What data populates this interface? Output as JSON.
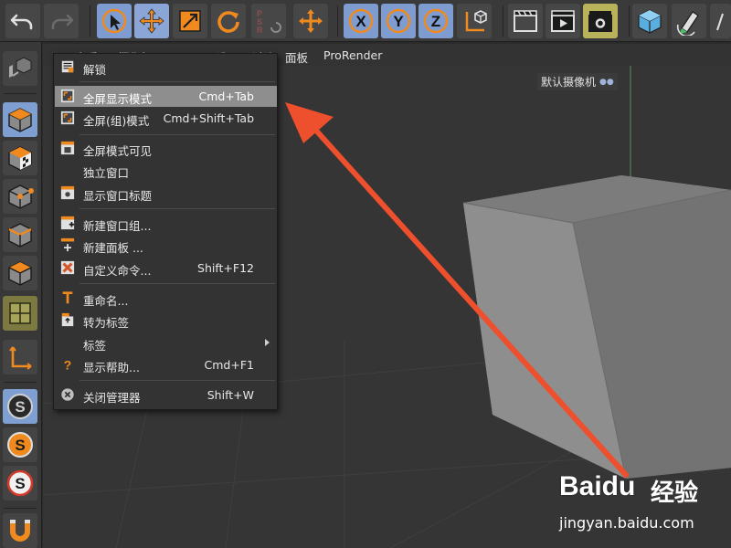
{
  "viewport_menubar": {
    "items": [
      "查看",
      "摄像机",
      "显示",
      "选项",
      "过滤",
      "面板",
      "ProRender"
    ]
  },
  "viewport": {
    "camera_label": "默认摄像机"
  },
  "context_menu": {
    "items": [
      {
        "label": "解锁",
        "shortcut": "",
        "icon": "unlock-icon"
      },
      {
        "label": "全屏显示模式",
        "shortcut": "Cmd+Tab",
        "icon": "fullscreen-icon",
        "highlighted": true
      },
      {
        "label": "全屏(组)模式",
        "shortcut": "Cmd+Shift+Tab",
        "icon": "fullscreen-group-icon"
      },
      {
        "label": "全屏模式可见",
        "shortcut": "",
        "icon": "fullscreen-visible-icon"
      },
      {
        "label": "独立窗口",
        "shortcut": "",
        "icon": ""
      },
      {
        "label": "显示窗口标题",
        "shortcut": "",
        "icon": "window-title-icon"
      },
      {
        "label": "新建窗口组...",
        "shortcut": "",
        "icon": "new-window-group-icon"
      },
      {
        "label": "新建面板 ...",
        "shortcut": "",
        "icon": "new-panel-icon"
      },
      {
        "label": "自定义命令...",
        "shortcut": "Shift+F12",
        "icon": "custom-command-icon"
      },
      {
        "label": "重命名...",
        "shortcut": "",
        "icon": "rename-icon"
      },
      {
        "label": "转为标签",
        "shortcut": "",
        "icon": "to-tab-icon"
      },
      {
        "label": "标签",
        "shortcut": "",
        "icon": "",
        "submenu": true
      },
      {
        "label": "显示帮助...",
        "shortcut": "Cmd+F1",
        "icon": "help-icon"
      },
      {
        "label": "关闭管理器",
        "shortcut": "Shift+W",
        "icon": "close-manager-icon"
      }
    ]
  },
  "toolbar": {
    "coord_buttons": [
      "X",
      "Y",
      "Z"
    ]
  },
  "watermark": {
    "brand": "Baidu",
    "cn": "经验",
    "url": "jingyan.baidu.com"
  },
  "colors": {
    "accent_select": "#7e9ccf",
    "menu_highlight": "#8e8e8e",
    "annotation_arrow": "#ee4f2d",
    "cube": "#8a8a8a"
  }
}
